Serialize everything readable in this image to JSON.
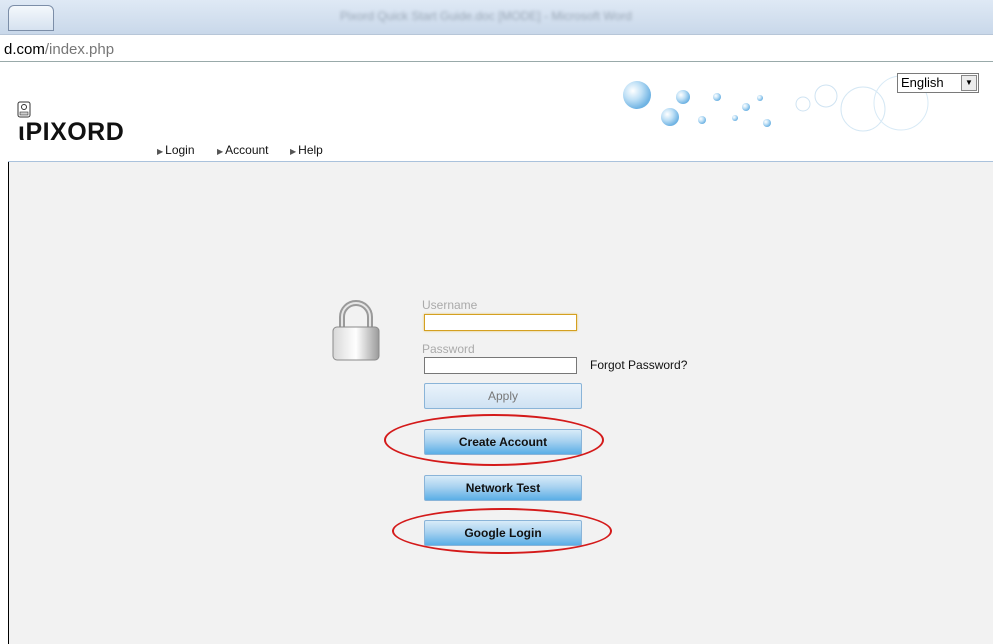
{
  "window": {
    "title": "Pixord Quick Start Guide.doc [MODE] - Microsoft Word"
  },
  "address_bar": {
    "url_host": "d.com",
    "url_path": "/index.php"
  },
  "header": {
    "logo_text": "ιPIXORD",
    "nav": [
      "Login",
      "Account",
      "Help"
    ],
    "language": "English"
  },
  "login": {
    "username_label": "Username",
    "username_value": "",
    "password_label": "Password",
    "password_value": "",
    "forgot_label": "Forgot Password?",
    "apply_label": "Apply",
    "create_account_label": "Create Account",
    "network_test_label": "Network Test",
    "google_login_label": "Google Login"
  },
  "colors": {
    "annotation_circle": "#d41a1a",
    "button_blue": "#5aaee6",
    "header_rule": "#aac2dc",
    "content_bg": "#f2f2f2"
  }
}
